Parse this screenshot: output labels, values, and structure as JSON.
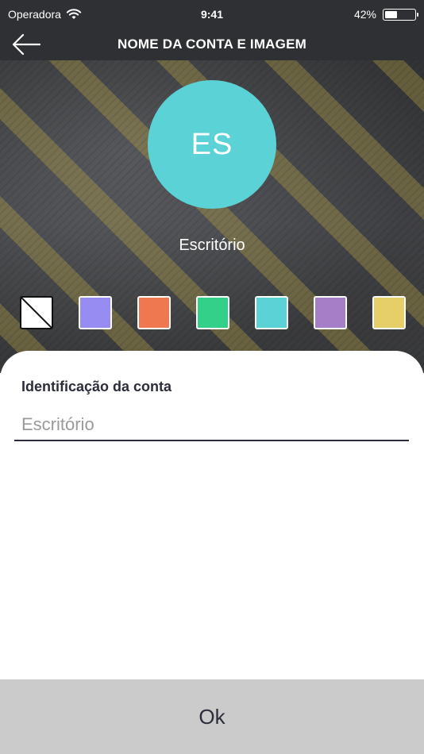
{
  "status_bar": {
    "carrier": "Operadora",
    "time": "9:41",
    "battery_percent": "42%",
    "battery_level": 0.42,
    "icons": [
      "wifi-icon",
      "battery-icon"
    ]
  },
  "nav": {
    "title": "NOME DA CONTA E IMAGEM",
    "back_icon": "arrow-left-icon"
  },
  "avatar": {
    "initials": "ES",
    "color": "#5bd2d6"
  },
  "account": {
    "name": "Escritório"
  },
  "swatches": [
    {
      "name": "none",
      "color": "#ffffff",
      "selected": true
    },
    {
      "name": "lavender",
      "color": "#968cf2",
      "selected": false
    },
    {
      "name": "orange",
      "color": "#f07850",
      "selected": false
    },
    {
      "name": "green",
      "color": "#32d088",
      "selected": false
    },
    {
      "name": "cyan",
      "color": "#5bd2d6",
      "selected": false
    },
    {
      "name": "purple",
      "color": "#a67ec8",
      "selected": false
    },
    {
      "name": "yellow",
      "color": "#e6cf68",
      "selected": false
    }
  ],
  "form": {
    "label": "Identificação da conta",
    "input_value": "Escritório",
    "input_placeholder": "Escritório"
  },
  "footer": {
    "ok_label": "Ok"
  }
}
